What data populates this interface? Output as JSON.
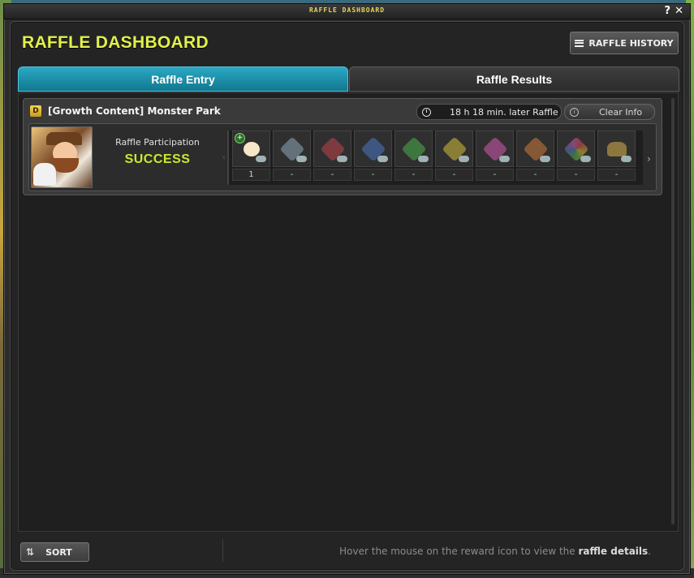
{
  "window": {
    "titlebar_text": "RAFFLE DASHBOARD",
    "help_label": "?",
    "close_label": "✕"
  },
  "header": {
    "title": "RAFFLE DASHBOARD",
    "history_button": "RAFFLE HISTORY"
  },
  "tabs": [
    {
      "label": "Raffle Entry",
      "active": true
    },
    {
      "label": "Raffle Results",
      "active": false
    }
  ],
  "entry": {
    "badge": "D",
    "title": "[Growth Content] Monster Park",
    "timer": "18 h 18 min. later Raffle",
    "clear_button": "Clear Info",
    "participation_label": "Raffle Participation",
    "participation_status": "SUCCESS",
    "rewards": [
      {
        "icon": "npc-character-icon",
        "value": "1",
        "color": "#f7e6c8"
      },
      {
        "icon": "silver-gem-icon",
        "value": "-",
        "color": "#8fa7b8"
      },
      {
        "icon": "red-gem-icon",
        "value": "-",
        "color": "#c0444a"
      },
      {
        "icon": "blue-gem-icon",
        "value": "-",
        "color": "#4a78c4"
      },
      {
        "icon": "green-gem-icon",
        "value": "-",
        "color": "#4ab04a"
      },
      {
        "icon": "yellow-gem-icon",
        "value": "-",
        "color": "#d6c03a"
      },
      {
        "icon": "pink-gem-icon",
        "value": "-",
        "color": "#d45ab0"
      },
      {
        "icon": "orange-gem-icon",
        "value": "-",
        "color": "#d07a3a"
      },
      {
        "icon": "rainbow-gem-icon",
        "value": "-",
        "color": "#c9a45a"
      },
      {
        "icon": "golden-creature-icon",
        "value": "-",
        "color": "#d8b34a"
      }
    ]
  },
  "footer": {
    "sort_button": "SORT",
    "hint_prefix": "Hover the mouse on the reward icon to view the ",
    "hint_bold": "raffle details",
    "hint_suffix": "."
  },
  "colors": {
    "title_yellow": "#e2f04a",
    "success_green": "#c8ea2c",
    "tab_active": "#1a8fa8"
  }
}
